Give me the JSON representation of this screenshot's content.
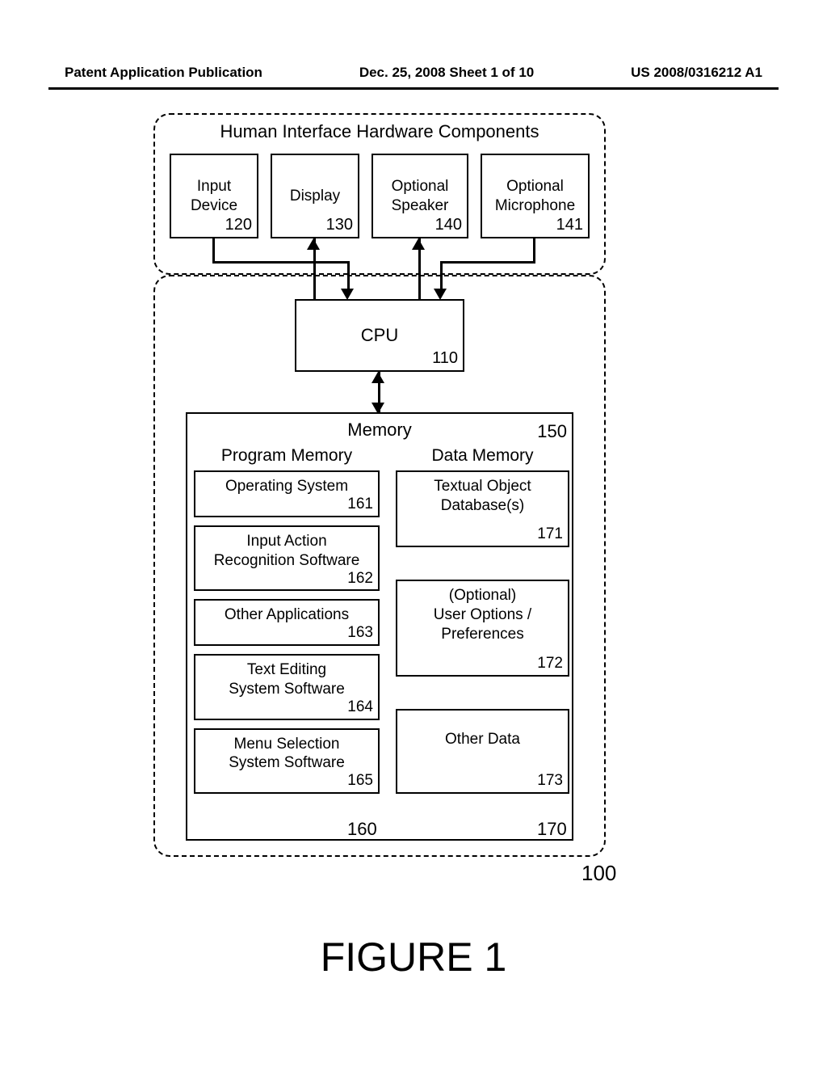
{
  "header": {
    "left": "Patent Application Publication",
    "center": "Dec. 25, 2008  Sheet 1 of 10",
    "right": "US 2008/0316212 A1"
  },
  "sections": {
    "top_title": "Human Interface Hardware Components"
  },
  "blocks": {
    "input_device": {
      "label": "Input\nDevice",
      "ref": "120"
    },
    "display": {
      "label": "Display",
      "ref": "130"
    },
    "speaker": {
      "label": "Optional\nSpeaker",
      "ref": "140"
    },
    "microphone": {
      "label": "Optional\nMicrophone",
      "ref": "141"
    },
    "cpu": {
      "label": "CPU",
      "ref": "110"
    },
    "memory": {
      "label": "Memory",
      "ref": "150"
    }
  },
  "program_memory": {
    "title": "Program Memory",
    "items": [
      {
        "label": "Operating System",
        "ref": "161"
      },
      {
        "label": "Input Action\nRecognition Software",
        "ref": "162"
      },
      {
        "label": "Other Applications",
        "ref": "163"
      },
      {
        "label": "Text Editing\nSystem Software",
        "ref": "164"
      },
      {
        "label": "Menu Selection\nSystem Software",
        "ref": "165"
      }
    ],
    "bottom_ref": "160"
  },
  "data_memory": {
    "title": "Data Memory",
    "items": [
      {
        "label": "Textual Object\nDatabase(s)",
        "ref": "171"
      },
      {
        "label": "(Optional)\nUser Options /\nPreferences",
        "ref": "172"
      },
      {
        "label": "Other Data",
        "ref": "173"
      }
    ],
    "bottom_ref": "170"
  },
  "whole_ref": "100",
  "figure_label": "FIGURE 1"
}
